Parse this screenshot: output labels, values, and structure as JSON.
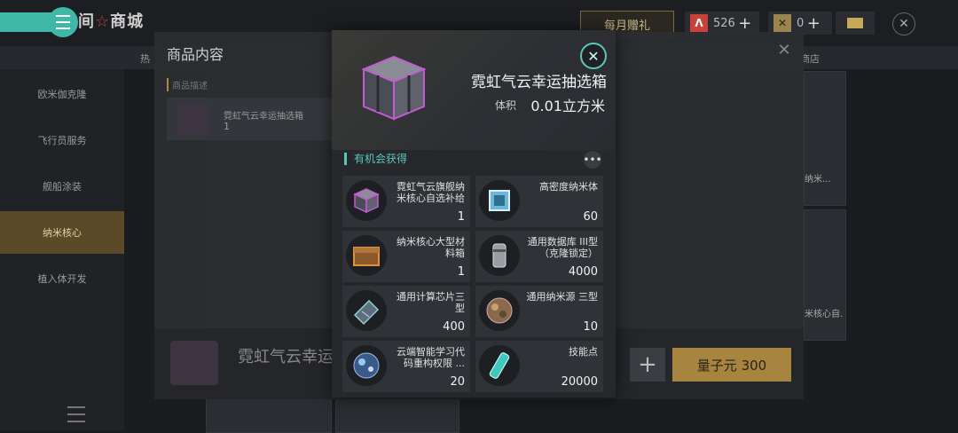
{
  "header": {
    "title_left": "间",
    "title_star": "☆",
    "title_right": "商城",
    "monthly_gift": "每月赠礼",
    "currency1_value": "526",
    "currency2_value": "0",
    "plus": "+",
    "close": "✕"
  },
  "tabs": {
    "hot": "热",
    "right_tab": "商店"
  },
  "sidebar": {
    "items": [
      {
        "label": "欧米伽克隆"
      },
      {
        "label": "飞行员服务"
      },
      {
        "label": "舰船涂装"
      },
      {
        "label": "纳米核心"
      },
      {
        "label": "植入体开发"
      }
    ]
  },
  "background_cards": {
    "card1_name": "纳米...",
    "card2_name": "米核心自..."
  },
  "dim_modal": {
    "title": "商品内容",
    "subtitle": "商品描述",
    "item_name": "霓虹气云幸运抽选箱",
    "item_count": "1",
    "footer_name": "霓虹气云幸运",
    "buy_label": "量子元 300",
    "plus": "+",
    "close": "✕"
  },
  "popup": {
    "item_name": "霓虹气云幸运抽选箱",
    "volume_label": "体积",
    "volume_value": "0.01立方米",
    "section_title": "有机会获得",
    "more": "•••",
    "close": "✕",
    "rewards": [
      {
        "name": "霓虹气云旗舰纳米核心自选补给",
        "count": "1"
      },
      {
        "name": "高密度纳米体",
        "count": "60"
      },
      {
        "name": "纳米核心大型材料箱",
        "count": "1"
      },
      {
        "name": "通用数据库 III型（克隆锁定）",
        "count": "4000"
      },
      {
        "name": "通用计算芯片三型",
        "count": "400"
      },
      {
        "name": "通用纳米源 三型",
        "count": "10"
      },
      {
        "name": "云端智能学习代码重构权限 ...",
        "count": "20"
      },
      {
        "name": "技能点",
        "count": "20000"
      }
    ]
  },
  "colors": {
    "accent": "#5cc6b6",
    "gold": "#a7853f",
    "box_glow": "#c45bd6"
  }
}
